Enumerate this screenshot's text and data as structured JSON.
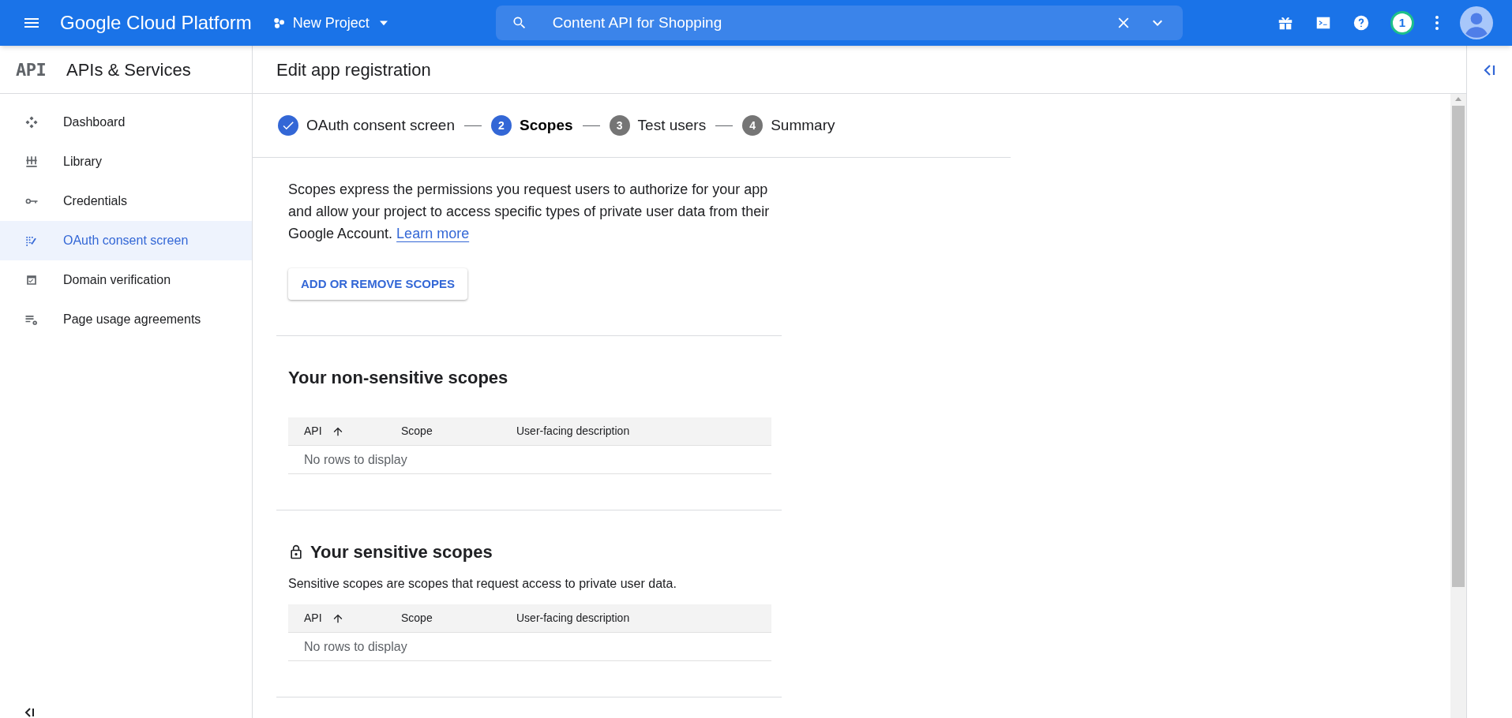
{
  "top_bar": {
    "product": "Google Cloud Platform",
    "project": "New Project",
    "search": {
      "value": "Content API for Shopping"
    },
    "notification_count": "1"
  },
  "sidebar": {
    "title": "APIs & Services",
    "logo": "API",
    "items": [
      {
        "label": "Dashboard",
        "selected": false
      },
      {
        "label": "Library",
        "selected": false
      },
      {
        "label": "Credentials",
        "selected": false
      },
      {
        "label": "OAuth consent screen",
        "selected": true
      },
      {
        "label": "Domain verification",
        "selected": false
      },
      {
        "label": "Page usage agreements",
        "selected": false
      }
    ]
  },
  "page": {
    "title": "Edit app registration",
    "steps": [
      {
        "label": "OAuth consent screen",
        "completed": true,
        "selected": false
      },
      {
        "number": "2",
        "label": "Scopes",
        "completed": false,
        "selected": true
      },
      {
        "number": "3",
        "label": "Test users",
        "completed": false,
        "selected": false
      },
      {
        "number": "4",
        "label": "Summary",
        "completed": false,
        "selected": false
      }
    ],
    "intro": "Scopes express the permissions you request users to authorize for your app and allow your project to access specific types of private user data from their Google Account.",
    "learn_more": "Learn more",
    "add_button": "ADD OR REMOVE SCOPES",
    "sections": [
      {
        "title": "Your non-sensitive scopes",
        "locked": false,
        "columns": [
          "API",
          "Scope",
          "User-facing description"
        ],
        "empty": "No rows to display"
      },
      {
        "title": "Your sensitive scopes",
        "locked": true,
        "description": "Sensitive scopes are scopes that request access to private user data.",
        "columns": [
          "API",
          "Scope",
          "User-facing description"
        ],
        "empty": "No rows to display"
      }
    ]
  }
}
